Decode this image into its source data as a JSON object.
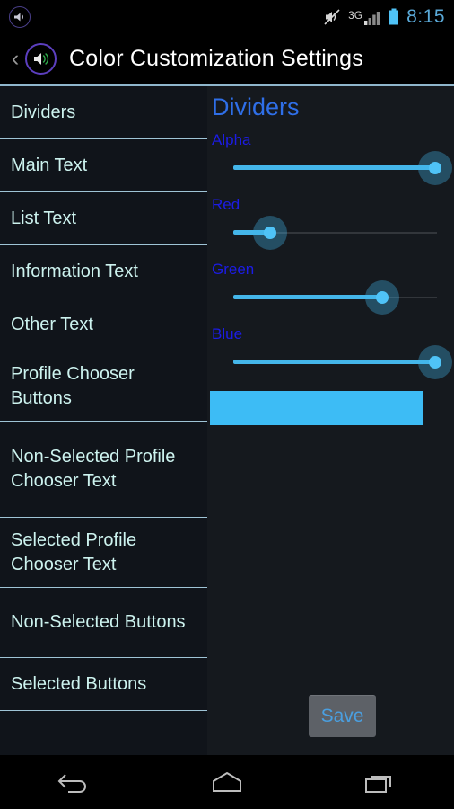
{
  "statusbar": {
    "app_icon": "volume-circle-icon",
    "icons": [
      "volume-muted-icon",
      "signal-3g-icon",
      "battery-icon"
    ],
    "network_label": "3G",
    "time": "8:15"
  },
  "actionbar": {
    "back_glyph": "‹",
    "back_icon": "back-chevron-icon",
    "app_icon": "volume-speaker-icon",
    "title": "Color Customization Settings",
    "underline_color": "#8fb6cc"
  },
  "sidebar": {
    "items": [
      {
        "label": "Dividers"
      },
      {
        "label": "Main Text"
      },
      {
        "label": "List Text"
      },
      {
        "label": "Information Text"
      },
      {
        "label": "Other Text"
      },
      {
        "label": "Profile Chooser Buttons"
      },
      {
        "label": "Non-Selected Profile Chooser Text"
      },
      {
        "label": "Selected Profile Chooser Text"
      },
      {
        "label": "Non-Selected Buttons"
      },
      {
        "label": "Selected Buttons"
      }
    ],
    "text_color": "#cdf3ef",
    "divider_color": "#9fc4d6"
  },
  "pane": {
    "title": "Dividers",
    "title_color": "#2f6fe8",
    "label_color": "#1c1ce4",
    "accent_color": "#44b6ea",
    "sliders": [
      {
        "label": "Alpha",
        "percent": 99
      },
      {
        "label": "Red",
        "percent": 18
      },
      {
        "label": "Green",
        "percent": 73
      },
      {
        "label": "Blue",
        "percent": 99
      }
    ],
    "preview_color": "#3dbcf5",
    "save_label": "Save",
    "save_text_color": "#4a9fe0",
    "save_bg_color": "#5d6167"
  },
  "navbar": {
    "buttons": [
      {
        "name": "back",
        "icon": "back-arrow-icon"
      },
      {
        "name": "home",
        "icon": "home-icon"
      },
      {
        "name": "recents",
        "icon": "recents-icon"
      }
    ]
  }
}
